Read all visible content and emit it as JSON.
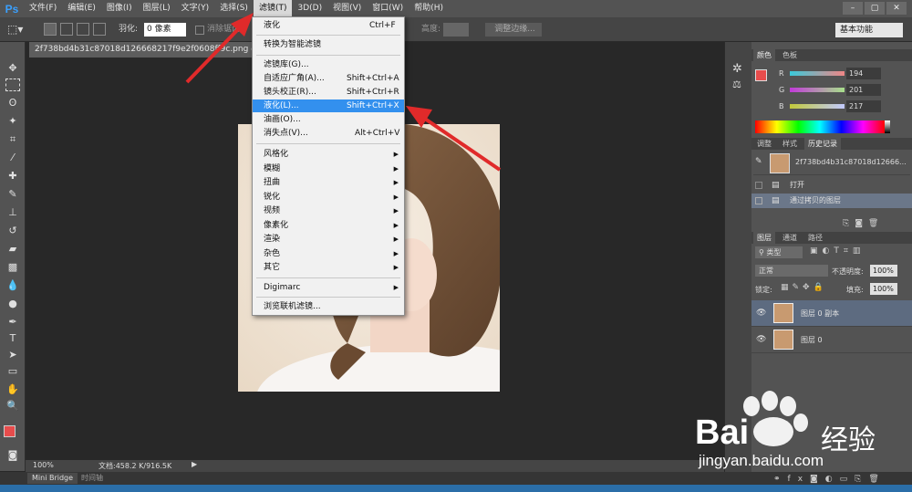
{
  "app": {
    "logo": "Ps"
  },
  "menubar": {
    "items": [
      "文件(F)",
      "编辑(E)",
      "图像(I)",
      "图层(L)",
      "文字(Y)",
      "选择(S)",
      "滤镜(T)",
      "3D(D)",
      "视图(V)",
      "窗口(W)",
      "帮助(H)"
    ],
    "active": "滤镜(T)",
    "window_buttons": [
      "–",
      "▢",
      "✕"
    ]
  },
  "options": {
    "feather_label": "羽化:",
    "feather_value": "0 像素",
    "antialias_label": "消除锯齿",
    "height_label": "高度:",
    "refine_edge": "调整边缘...",
    "workspace": "基本功能"
  },
  "document": {
    "tab_title": "2f738bd4b31c87018d126668217f9e2f0608ff9c.png @ 100%",
    "zoom": "100%",
    "doc_size": "文档:458.2 K/916.5K"
  },
  "filter_menu": {
    "items": [
      {
        "label": "液化",
        "shortcut": "Ctrl+F"
      },
      {
        "label": "转换为智能滤镜",
        "shortcut": ""
      },
      {
        "label": "滤镜库(G)...",
        "shortcut": ""
      },
      {
        "label": "自适应广角(A)...",
        "shortcut": "Shift+Ctrl+A"
      },
      {
        "label": "镜头校正(R)...",
        "shortcut": "Shift+Ctrl+R"
      },
      {
        "label": "液化(L)...",
        "shortcut": "Shift+Ctrl+X",
        "highlighted": true
      },
      {
        "label": "油画(O)...",
        "shortcut": ""
      },
      {
        "label": "消失点(V)...",
        "shortcut": "Alt+Ctrl+V"
      },
      {
        "label": "风格化",
        "submenu": true
      },
      {
        "label": "模糊",
        "submenu": true
      },
      {
        "label": "扭曲",
        "submenu": true
      },
      {
        "label": "锐化",
        "submenu": true
      },
      {
        "label": "视频",
        "submenu": true
      },
      {
        "label": "像素化",
        "submenu": true
      },
      {
        "label": "渲染",
        "submenu": true
      },
      {
        "label": "杂色",
        "submenu": true
      },
      {
        "label": "其它",
        "submenu": true
      },
      {
        "label": "Digimarc",
        "submenu": true
      },
      {
        "label": "浏览联机滤镜...",
        "shortcut": ""
      }
    ]
  },
  "color_panel": {
    "tabs": [
      "颜色",
      "色板"
    ],
    "channels": [
      {
        "name": "R",
        "value": "194"
      },
      {
        "name": "G",
        "value": "201"
      },
      {
        "name": "B",
        "value": "217"
      }
    ],
    "fg_color": "#e74c4c",
    "bg_color": "#ffffff"
  },
  "history_panel": {
    "tabs": [
      "调整",
      "样式",
      "历史记录"
    ],
    "snapshot": "2f738bd4b31c87018d12666...",
    "items": [
      "打开",
      "通过拷贝的图层"
    ]
  },
  "layers_panel": {
    "tabs": [
      "图层",
      "通道",
      "路径"
    ],
    "kind": "类型",
    "blend_mode": "正常",
    "opacity_label": "不透明度:",
    "opacity_value": "100%",
    "lock_label": "锁定:",
    "fill_label": "填充:",
    "fill_value": "100%",
    "layers": [
      {
        "name": "图层 0 副本",
        "selected": true
      },
      {
        "name": "图层 0",
        "selected": false
      }
    ]
  },
  "bottom_tabs": [
    "Mini Bridge",
    "时间轴"
  ],
  "watermark": {
    "brand_a": "Bai",
    "brand_b": "经验",
    "url": "jingyan.baidu.com"
  },
  "colors": {
    "accent": "#3390ee",
    "arrow": "#e02a2a"
  }
}
